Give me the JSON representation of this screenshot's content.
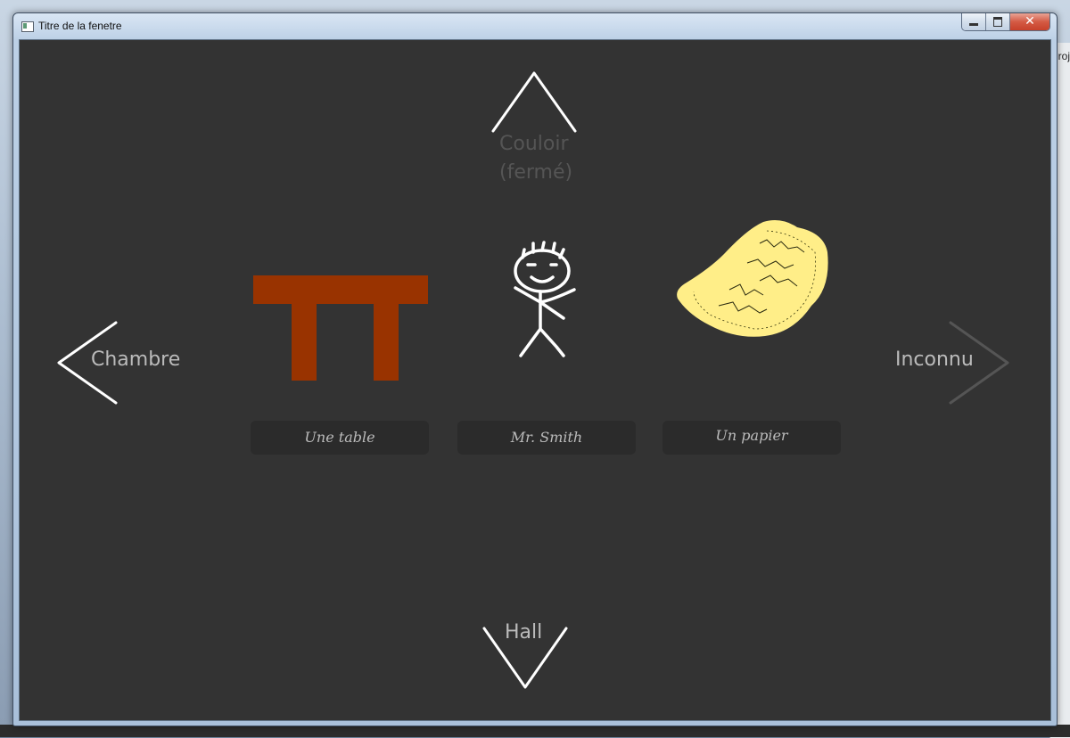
{
  "window": {
    "title": "Titre de la fenetre",
    "close_glyph": "✕"
  },
  "background": {
    "partial_label": "Proj"
  },
  "navigation": {
    "up": {
      "label_line1": "Couloir",
      "label_line2": "(fermé)",
      "enabled": false,
      "icon": "chevron-up-icon"
    },
    "left": {
      "label": "Chambre",
      "enabled": true,
      "icon": "chevron-left-icon"
    },
    "right": {
      "label": "Inconnu",
      "enabled": false,
      "icon": "chevron-right-icon"
    },
    "down": {
      "label": "Hall",
      "enabled": true,
      "icon": "chevron-down-icon"
    }
  },
  "objects": [
    {
      "name": "Une table",
      "icon": "table-icon",
      "color": "#993300"
    },
    {
      "name": "Mr. Smith",
      "icon": "stick-figure-icon",
      "color": "#ffffff"
    },
    {
      "name": "Un papier",
      "icon": "paper-icon",
      "color": "#ffee88"
    }
  ],
  "colors": {
    "scene_background": "#333333",
    "enabled_text": "#bbbbbb",
    "disabled_text": "#555555",
    "enabled_arrow": "#ffffff",
    "disabled_arrow": "#555555"
  }
}
